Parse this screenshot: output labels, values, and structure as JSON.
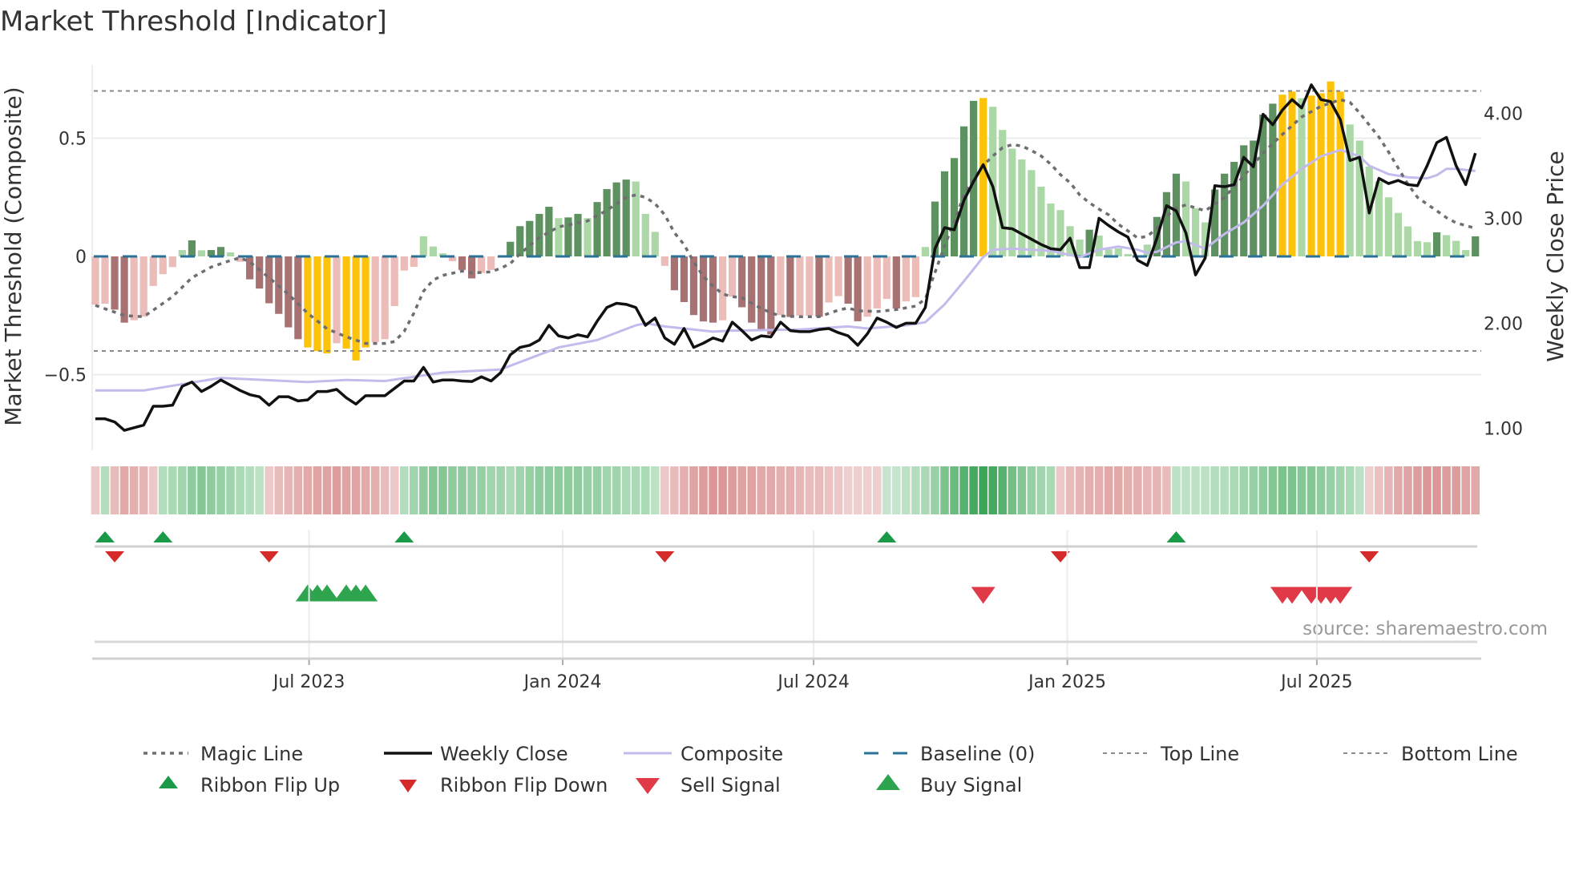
{
  "title": "Market Threshold [Indicator]",
  "source": "source: sharemaestro.com",
  "colors": {
    "bar_dark_red": "#a87272",
    "bar_light_red": "#ecbcb8",
    "bar_dark_green": "#5e9160",
    "bar_light_green": "#acd8a8",
    "bar_gold": "#fcc30a",
    "weekly_close": "#111111",
    "composite": "#c3bbec",
    "magic": "#6e6e72",
    "baseline": "#2b7299",
    "threshold": "#8a8a8a",
    "flip_up": "#1a9a48",
    "flip_down": "#d42a2a",
    "buy": "#2ea44f",
    "sell": "#e03a48"
  },
  "chart_data": {
    "type": "bar+line",
    "title": "Market Threshold [Indicator]",
    "x_start_date": "2023-01-27",
    "x_step_days": 7,
    "left_axis": {
      "label": "Market Threshold (Composite)",
      "ylim": [
        -0.82,
        0.81
      ],
      "ticks": [
        {
          "v": 0.5,
          "label": "0.5"
        },
        {
          "v": 0,
          "label": "0"
        },
        {
          "v": -0.5,
          "label": "−0.5"
        }
      ]
    },
    "right_axis": {
      "label": "Weekly Close Price",
      "ylim": [
        0.79,
        4.46
      ],
      "ticks": [
        {
          "v": 4,
          "label": "4.00"
        },
        {
          "v": 3,
          "label": "3.00"
        },
        {
          "v": 2,
          "label": "2.00"
        },
        {
          "v": 1,
          "label": "1.00"
        }
      ]
    },
    "x_ticks": [
      {
        "date": "2023-07-01",
        "label": "Jul 2023"
      },
      {
        "date": "2024-01-01",
        "label": "Jan 2024"
      },
      {
        "date": "2024-07-01",
        "label": "Jul 2024"
      },
      {
        "date": "2025-01-01",
        "label": "Jan 2025"
      },
      {
        "date": "2025-07-01",
        "label": "Jul 2025"
      }
    ],
    "top_line": 0.7,
    "bottom_line": -0.4,
    "baseline": 0,
    "composite_bars": [
      -0.204,
      -0.2,
      -0.225,
      -0.28,
      -0.27,
      -0.255,
      -0.125,
      -0.075,
      -0.045,
      0.027,
      0.068,
      0.026,
      0.027,
      0.04,
      0.017,
      -0.023,
      -0.097,
      -0.136,
      -0.198,
      -0.243,
      -0.3,
      -0.35,
      -0.385,
      -0.4,
      -0.41,
      -0.367,
      -0.39,
      -0.44,
      -0.385,
      -0.363,
      -0.35,
      -0.21,
      -0.06,
      -0.044,
      0.085,
      0.042,
      0.013,
      -0.02,
      -0.057,
      -0.093,
      -0.07,
      -0.057,
      -0.005,
      0.062,
      0.128,
      0.15,
      0.18,
      0.21,
      0.162,
      0.165,
      0.18,
      0.162,
      0.23,
      0.285,
      0.313,
      0.325,
      0.317,
      0.18,
      0.104,
      -0.04,
      -0.143,
      -0.193,
      -0.248,
      -0.275,
      -0.28,
      -0.27,
      -0.17,
      -0.215,
      -0.28,
      -0.31,
      -0.33,
      -0.248,
      -0.256,
      -0.25,
      -0.25,
      -0.255,
      -0.195,
      -0.168,
      -0.2,
      -0.274,
      -0.255,
      -0.22,
      -0.18,
      -0.22,
      -0.19,
      -0.172,
      0.04,
      0.232,
      0.36,
      0.416,
      0.55,
      0.658,
      0.67,
      0.633,
      0.535,
      0.456,
      0.41,
      0.365,
      0.295,
      0.224,
      0.196,
      0.128,
      0.071,
      0.113,
      0.088,
      0.03,
      0.034,
      0.01,
      0.005,
      0.05,
      0.167,
      0.272,
      0.35,
      0.317,
      0.204,
      0.144,
      0.283,
      0.35,
      0.4,
      0.47,
      0.49,
      0.6,
      0.646,
      0.684,
      0.697,
      0.669,
      0.68,
      0.69,
      0.74,
      0.697,
      0.558,
      0.49,
      0.38,
      0.317,
      0.25,
      0.184,
      0.127,
      0.065,
      0.06,
      0.102,
      0.09,
      0.066,
      0.027,
      0.085
    ],
    "bar_classes": [
      "lr",
      "lr",
      "dr",
      "dr",
      "lr",
      "lr",
      "lr",
      "lr",
      "lr",
      "lg",
      "dg",
      "lg",
      "dg",
      "dg",
      "lg",
      "lr",
      "dr",
      "dr",
      "dr",
      "dr",
      "dr",
      "dr",
      "y",
      "y",
      "y",
      "lr",
      "y",
      "y",
      "y",
      "lr",
      "lr",
      "lr",
      "lr",
      "lr",
      "lg",
      "lg",
      "lg",
      "lr",
      "dr",
      "dr",
      "lr",
      "lr",
      "lr",
      "dg",
      "dg",
      "dg",
      "dg",
      "dg",
      "lg",
      "dg",
      "dg",
      "lg",
      "dg",
      "dg",
      "dg",
      "dg",
      "lg",
      "lg",
      "lg",
      "lr",
      "dr",
      "dr",
      "dr",
      "dr",
      "dr",
      "lr",
      "lr",
      "dr",
      "dr",
      "dr",
      "dr",
      "lr",
      "dr",
      "lr",
      "lr",
      "dr",
      "lr",
      "lr",
      "dr",
      "dr",
      "lr",
      "lr",
      "lr",
      "dr",
      "lr",
      "lr",
      "lg",
      "dg",
      "dg",
      "dg",
      "dg",
      "dg",
      "y",
      "lg",
      "lg",
      "lg",
      "lg",
      "lg",
      "lg",
      "lg",
      "lg",
      "lg",
      "lg",
      "dg",
      "lg",
      "lg",
      "lg",
      "lg",
      "lg",
      "lg",
      "dg",
      "dg",
      "dg",
      "lg",
      "lg",
      "lg",
      "dg",
      "dg",
      "dg",
      "dg",
      "dg",
      "dg",
      "dg",
      "y",
      "y",
      "lg",
      "y",
      "y",
      "y",
      "y",
      "lg",
      "lg",
      "lg",
      "lg",
      "lg",
      "lg",
      "lg",
      "lg",
      "lg",
      "dg",
      "lg",
      "lg",
      "lg",
      "dg"
    ],
    "weekly_close": [
      1.09,
      1.09,
      1.06,
      0.98,
      1.005,
      1.03,
      1.21,
      1.21,
      1.22,
      1.4,
      1.44,
      1.35,
      1.4,
      1.46,
      1.41,
      1.36,
      1.32,
      1.3,
      1.22,
      1.3,
      1.3,
      1.26,
      1.27,
      1.35,
      1.35,
      1.37,
      1.29,
      1.23,
      1.31,
      1.31,
      1.31,
      1.38,
      1.45,
      1.45,
      1.58,
      1.44,
      1.46,
      1.46,
      1.45,
      1.445,
      1.49,
      1.45,
      1.53,
      1.7,
      1.77,
      1.79,
      1.84,
      1.98,
      1.88,
      1.86,
      1.89,
      1.87,
      2.02,
      2.15,
      2.19,
      2.18,
      2.15,
      1.98,
      2.05,
      1.86,
      1.8,
      1.95,
      1.77,
      1.81,
      1.86,
      1.83,
      2.01,
      1.93,
      1.84,
      1.88,
      1.87,
      2.01,
      1.93,
      1.92,
      1.92,
      1.94,
      1.95,
      1.91,
      1.88,
      1.79,
      1.9,
      2.05,
      2.01,
      1.96,
      2.0,
      2.0,
      2.15,
      2.71,
      2.91,
      2.89,
      3.17,
      3.35,
      3.51,
      3.3,
      2.91,
      2.9,
      2.85,
      2.8,
      2.75,
      2.71,
      2.7,
      2.81,
      2.53,
      2.53,
      3.0,
      2.93,
      2.87,
      2.82,
      2.6,
      2.55,
      2.81,
      3.12,
      3.07,
      2.86,
      2.46,
      2.62,
      3.31,
      3.3,
      3.32,
      3.58,
      3.49,
      3.99,
      3.89,
      4.03,
      4.13,
      4.05,
      4.27,
      4.13,
      4.11,
      3.94,
      3.55,
      3.58,
      3.05,
      3.38,
      3.33,
      3.36,
      3.32,
      3.31,
      3.5,
      3.72,
      3.77,
      3.5,
      3.32,
      3.62
    ],
    "composite_line": [
      [
        0,
        1.36
      ],
      [
        5,
        1.36
      ],
      [
        9,
        1.42
      ],
      [
        13,
        1.48
      ],
      [
        22,
        1.44
      ],
      [
        26,
        1.46
      ],
      [
        30,
        1.45
      ],
      [
        36,
        1.53
      ],
      [
        42,
        1.56
      ],
      [
        48,
        1.77
      ],
      [
        52,
        1.84
      ],
      [
        56,
        1.98
      ],
      [
        57,
        2.0
      ],
      [
        59,
        1.97
      ],
      [
        61,
        1.95
      ],
      [
        64,
        1.92
      ],
      [
        66,
        1.93
      ],
      [
        73,
        1.94
      ],
      [
        78,
        1.97
      ],
      [
        80,
        1.95
      ],
      [
        84,
        1.98
      ],
      [
        86,
        2.01
      ],
      [
        88,
        2.18
      ],
      [
        90,
        2.4
      ],
      [
        92,
        2.63
      ],
      [
        93,
        2.7
      ],
      [
        95,
        2.71
      ],
      [
        99,
        2.69
      ],
      [
        102,
        2.63
      ],
      [
        104,
        2.7
      ],
      [
        106,
        2.73
      ],
      [
        108,
        2.7
      ],
      [
        109,
        2.67
      ],
      [
        110,
        2.68
      ],
      [
        112,
        2.77
      ],
      [
        113,
        2.78
      ],
      [
        115,
        2.71
      ],
      [
        117,
        2.85
      ],
      [
        119,
        2.96
      ],
      [
        121,
        3.12
      ],
      [
        123,
        3.32
      ],
      [
        125,
        3.47
      ],
      [
        127,
        3.59
      ],
      [
        129,
        3.65
      ],
      [
        131,
        3.59
      ],
      [
        132,
        3.5
      ],
      [
        134,
        3.42
      ],
      [
        136,
        3.39
      ],
      [
        138,
        3.38
      ],
      [
        139,
        3.41
      ],
      [
        140,
        3.47
      ],
      [
        141,
        3.47
      ],
      [
        143,
        3.45
      ]
    ],
    "magic_line": [
      [
        0,
        -0.207
      ],
      [
        3,
        -0.25
      ],
      [
        5,
        -0.255
      ],
      [
        6,
        -0.227
      ],
      [
        8,
        -0.17
      ],
      [
        10,
        -0.09
      ],
      [
        12,
        -0.045
      ],
      [
        14,
        -0.017
      ],
      [
        15,
        -0.006
      ],
      [
        16,
        -0.023
      ],
      [
        18,
        -0.09
      ],
      [
        20,
        -0.16
      ],
      [
        22,
        -0.24
      ],
      [
        24,
        -0.306
      ],
      [
        26,
        -0.34
      ],
      [
        28,
        -0.368
      ],
      [
        30,
        -0.368
      ],
      [
        31,
        -0.36
      ],
      [
        32,
        -0.317
      ],
      [
        33,
        -0.24
      ],
      [
        34,
        -0.147
      ],
      [
        35,
        -0.1
      ],
      [
        36,
        -0.08
      ],
      [
        38,
        -0.062
      ],
      [
        39,
        -0.07
      ],
      [
        41,
        -0.065
      ],
      [
        42,
        -0.05
      ],
      [
        43,
        -0.03
      ],
      [
        44,
        0.011
      ],
      [
        46,
        0.08
      ],
      [
        48,
        0.125
      ],
      [
        51,
        0.15
      ],
      [
        53,
        0.195
      ],
      [
        55,
        0.25
      ],
      [
        56,
        0.26
      ],
      [
        57,
        0.25
      ],
      [
        58,
        0.223
      ],
      [
        59,
        0.176
      ],
      [
        60,
        0.1
      ],
      [
        61,
        0.05
      ],
      [
        62,
        -0.023
      ],
      [
        63,
        -0.085
      ],
      [
        64,
        -0.125
      ],
      [
        65,
        -0.159
      ],
      [
        66,
        -0.17
      ],
      [
        67,
        -0.175
      ],
      [
        68,
        -0.198
      ],
      [
        69,
        -0.22
      ],
      [
        70,
        -0.238
      ],
      [
        71,
        -0.252
      ],
      [
        73,
        -0.255
      ],
      [
        75,
        -0.255
      ],
      [
        77,
        -0.227
      ],
      [
        78,
        -0.218
      ],
      [
        79,
        -0.23
      ],
      [
        81,
        -0.233
      ],
      [
        83,
        -0.225
      ],
      [
        85,
        -0.21
      ],
      [
        86,
        -0.18
      ],
      [
        87,
        -0.068
      ],
      [
        88,
        0.045
      ],
      [
        89,
        0.147
      ],
      [
        90,
        0.26
      ],
      [
        91,
        0.33
      ],
      [
        92,
        0.385
      ],
      [
        93,
        0.425
      ],
      [
        94,
        0.46
      ],
      [
        95,
        0.473
      ],
      [
        96,
        0.467
      ],
      [
        97,
        0.448
      ],
      [
        98,
        0.425
      ],
      [
        99,
        0.39
      ],
      [
        100,
        0.346
      ],
      [
        101,
        0.312
      ],
      [
        102,
        0.26
      ],
      [
        103,
        0.227
      ],
      [
        104,
        0.2
      ],
      [
        105,
        0.176
      ],
      [
        106,
        0.136
      ],
      [
        107,
        0.108
      ],
      [
        108,
        0.078
      ],
      [
        109,
        0.085
      ],
      [
        110,
        0.119
      ],
      [
        111,
        0.17
      ],
      [
        112,
        0.204
      ],
      [
        113,
        0.218
      ],
      [
        115,
        0.193
      ],
      [
        117,
        0.25
      ],
      [
        119,
        0.34
      ],
      [
        121,
        0.437
      ],
      [
        123,
        0.516
      ],
      [
        125,
        0.59
      ],
      [
        127,
        0.635
      ],
      [
        129,
        0.663
      ],
      [
        130,
        0.652
      ],
      [
        131,
        0.607
      ],
      [
        132,
        0.556
      ],
      [
        133,
        0.505
      ],
      [
        134,
        0.442
      ],
      [
        135,
        0.374
      ],
      [
        136,
        0.306
      ],
      [
        137,
        0.25
      ],
      [
        138,
        0.221
      ],
      [
        139,
        0.193
      ],
      [
        140,
        0.164
      ],
      [
        141,
        0.142
      ],
      [
        143,
        0.119
      ]
    ],
    "ribbon": [
      -0.2,
      0.25,
      -0.3,
      -0.45,
      -0.4,
      -0.35,
      -0.2,
      0.25,
      0.3,
      0.35,
      0.45,
      0.5,
      0.45,
      0.4,
      0.35,
      0.3,
      0.25,
      0.2,
      -0.2,
      -0.3,
      -0.35,
      -0.4,
      -0.45,
      -0.5,
      -0.5,
      -0.55,
      -0.5,
      -0.5,
      -0.45,
      -0.4,
      -0.3,
      -0.2,
      0.25,
      0.35,
      0.45,
      0.5,
      0.5,
      0.45,
      0.45,
      0.4,
      0.4,
      0.35,
      0.35,
      0.3,
      0.35,
      0.4,
      0.45,
      0.45,
      0.45,
      0.45,
      0.45,
      0.4,
      0.4,
      0.35,
      0.35,
      0.3,
      0.3,
      0.3,
      0.2,
      -0.2,
      -0.3,
      -0.4,
      -0.5,
      -0.55,
      -0.6,
      -0.6,
      -0.55,
      -0.5,
      -0.5,
      -0.45,
      -0.45,
      -0.4,
      -0.4,
      -0.35,
      -0.3,
      -0.3,
      -0.25,
      -0.2,
      -0.15,
      -0.15,
      -0.15,
      -0.15,
      0.15,
      0.15,
      0.2,
      0.25,
      0.3,
      0.4,
      0.55,
      0.65,
      0.75,
      0.85,
      0.9,
      0.85,
      0.75,
      0.6,
      0.5,
      0.4,
      0.35,
      0.3,
      -0.2,
      -0.3,
      -0.35,
      -0.4,
      -0.4,
      -0.45,
      -0.45,
      -0.4,
      -0.4,
      -0.35,
      -0.35,
      -0.3,
      0.2,
      0.2,
      0.2,
      0.2,
      0.25,
      0.25,
      0.3,
      0.35,
      0.4,
      0.45,
      0.5,
      0.55,
      0.55,
      0.5,
      0.5,
      0.45,
      0.4,
      0.35,
      0.3,
      0.2,
      -0.15,
      -0.25,
      -0.35,
      -0.45,
      -0.5,
      -0.55,
      -0.6,
      -0.6,
      -0.55,
      -0.55,
      -0.5,
      -0.45
    ],
    "ribbon_flip_up": [
      1,
      7,
      32,
      82,
      112
    ],
    "ribbon_flip_down": [
      2,
      18,
      59,
      100,
      132
    ],
    "buy_signals": [
      22,
      23,
      24,
      26,
      27,
      28
    ],
    "sell_signals": [
      92,
      123,
      124,
      126,
      127,
      128,
      129
    ],
    "legend": {
      "placement": "bottom",
      "items": [
        {
          "key": "magic",
          "label": "Magic Line"
        },
        {
          "key": "close",
          "label": "Weekly Close"
        },
        {
          "key": "composite",
          "label": "Composite"
        },
        {
          "key": "baseline",
          "label": "Baseline (0)"
        },
        {
          "key": "top",
          "label": "Top Line"
        },
        {
          "key": "bottom",
          "label": "Bottom Line"
        },
        {
          "key": "flipup",
          "label": "Ribbon Flip Up"
        },
        {
          "key": "flipdown",
          "label": "Ribbon Flip Down"
        },
        {
          "key": "sell",
          "label": "Sell Signal"
        },
        {
          "key": "buy",
          "label": "Buy Signal"
        }
      ]
    }
  }
}
